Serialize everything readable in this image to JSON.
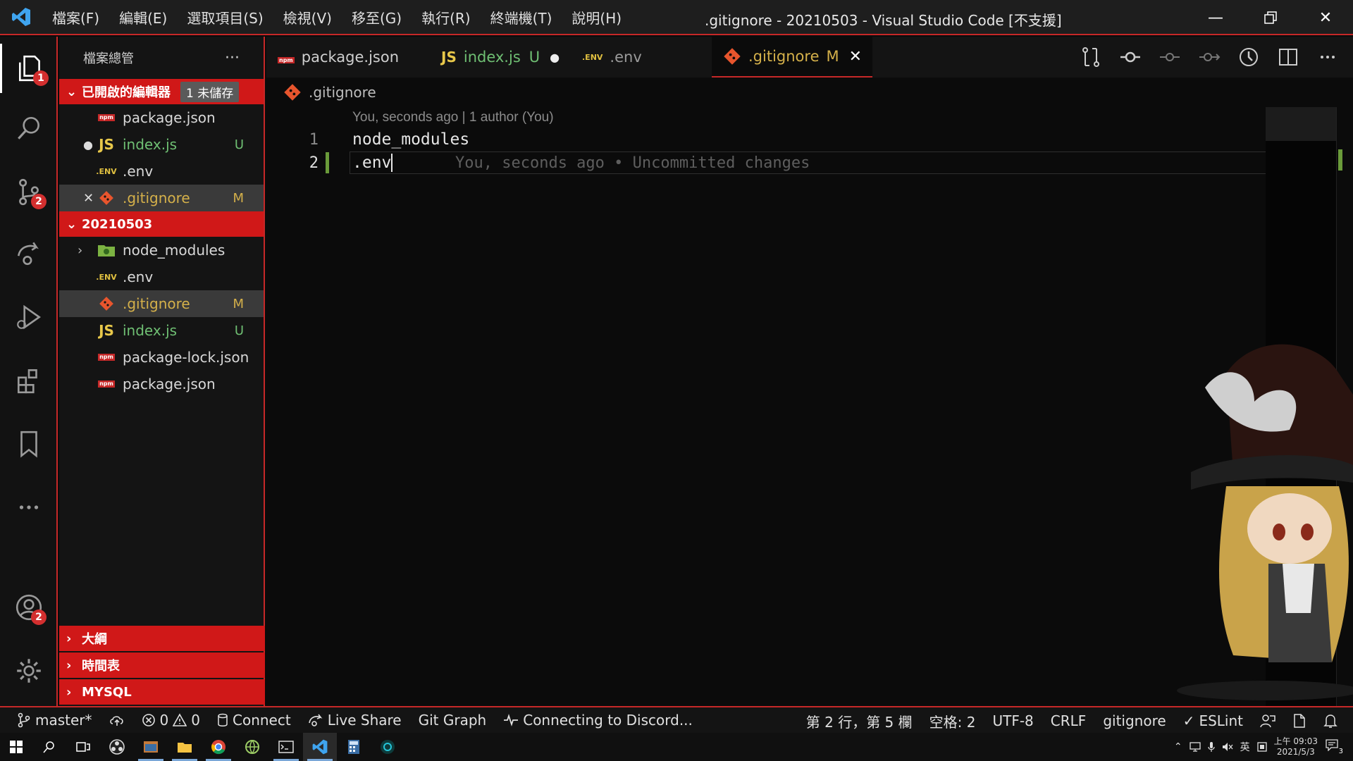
{
  "window": {
    "title": ".gitignore - 20210503 - Visual Studio Code [不支援]",
    "menu": [
      "檔案(F)",
      "編輯(E)",
      "選取項目(S)",
      "檢視(V)",
      "移至(G)",
      "執行(R)",
      "終端機(T)",
      "說明(H)"
    ]
  },
  "activity": {
    "explorer_badge": "1",
    "scm_badge": "2",
    "accounts_badge": "2"
  },
  "sidebar": {
    "title": "檔案總管",
    "more": "···",
    "open_editors": {
      "label": "已開啟的編輯器",
      "unsaved": "1 未儲存",
      "items": [
        {
          "name": "package.json",
          "status": ""
        },
        {
          "name": "index.js",
          "status": "U"
        },
        {
          "name": ".env",
          "status": ""
        },
        {
          "name": ".gitignore",
          "status": "M"
        }
      ]
    },
    "folder": {
      "label": "20210503",
      "items": [
        {
          "name": "node_modules",
          "status": ""
        },
        {
          "name": ".env",
          "status": ""
        },
        {
          "name": ".gitignore",
          "status": "M"
        },
        {
          "name": "index.js",
          "status": "U"
        },
        {
          "name": "package-lock.json",
          "status": ""
        },
        {
          "name": "package.json",
          "status": ""
        }
      ]
    },
    "panels": [
      "大綱",
      "時間表",
      "MYSQL"
    ]
  },
  "tabs": [
    {
      "label": "package.json",
      "status": ""
    },
    {
      "label": "index.js",
      "status": "U"
    },
    {
      "label": ".env",
      "status": ""
    },
    {
      "label": ".gitignore",
      "status": "M"
    }
  ],
  "breadcrumb": ".gitignore",
  "editor": {
    "codelens": "You, seconds ago | 1 author (You)",
    "lines": [
      {
        "num": "1",
        "text": "node_modules"
      },
      {
        "num": "2",
        "text": ".env"
      }
    ],
    "blame": "You, seconds ago • Uncommitted changes"
  },
  "statusbar": {
    "branch": "master*",
    "errors": "0",
    "warnings": "0",
    "connect": "Connect",
    "liveshare": "Live Share",
    "gitgraph": "Git Graph",
    "discord": "Connecting to Discord...",
    "position": "第 2 行，第 5 欄",
    "spaces": "空格: 2",
    "encoding": "UTF-8",
    "eol": "CRLF",
    "language": "gitignore",
    "eslint": "ESLint"
  },
  "taskbar": {
    "time": "上午 09:03",
    "date": "2021/5/3",
    "ime": "英",
    "notifications": "3"
  },
  "colors": {
    "accent": "#d01818",
    "untracked": "#6fbf73",
    "modified": "#d4b04a"
  }
}
